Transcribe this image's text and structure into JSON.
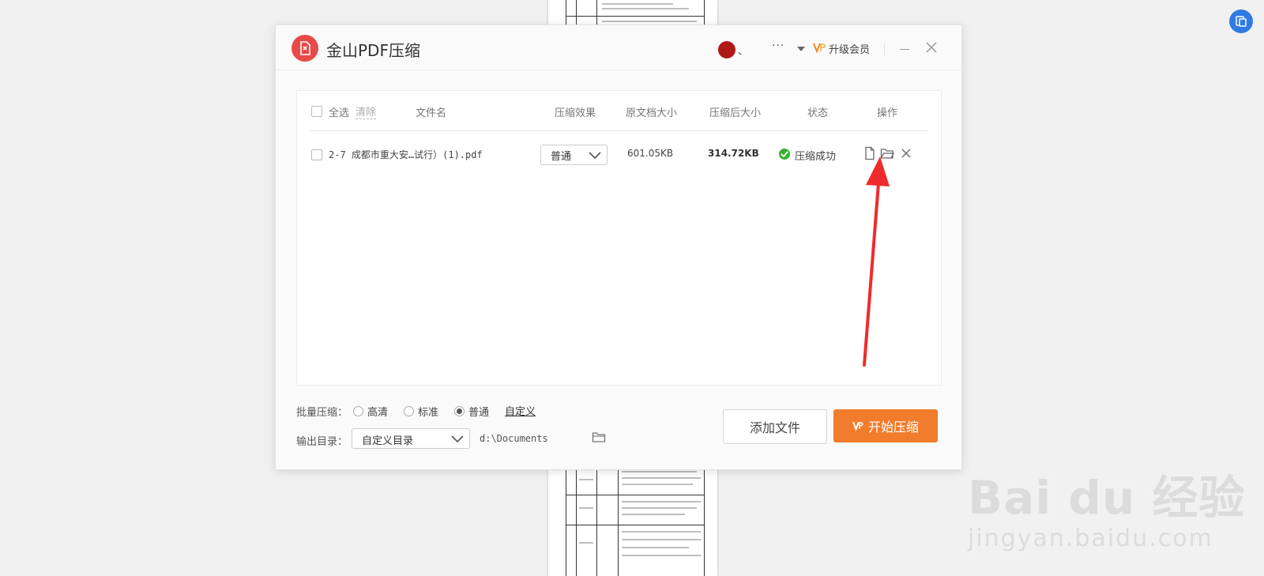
{
  "app": {
    "title": "金山PDF压缩",
    "user_suffix": "、",
    "more": "···",
    "upgrade_label": "升级会员"
  },
  "list": {
    "header": {
      "select_all": "全选",
      "clear": "清除",
      "filename": "文件名",
      "effect": "压缩效果",
      "orig_size": "原文档大小",
      "new_size": "压缩后大小",
      "status": "状态",
      "action": "操作"
    },
    "rows": [
      {
        "filename": "2-7 成都市重大安…试行）(1).pdf",
        "effect": "普通",
        "orig_size": "601.05KB",
        "new_size": "314.72KB",
        "status": "压缩成功"
      }
    ]
  },
  "batch": {
    "label": "批量压缩：",
    "options": [
      "高清",
      "标准",
      "普通"
    ],
    "selected": "普通",
    "custom": "自定义"
  },
  "output": {
    "label": "输出目录：",
    "mode": "自定义目录",
    "path": "d:\\Documents"
  },
  "buttons": {
    "add_file": "添加文件",
    "start": "开始压缩"
  },
  "watermark": {
    "brand": "Bai du 经验",
    "site": "jingyan.baidu.com"
  },
  "colors": {
    "accent": "#f07c2c",
    "success": "#3cb035",
    "logo": "#e84a4a",
    "annotation_arrow": "#ee2b2b"
  }
}
